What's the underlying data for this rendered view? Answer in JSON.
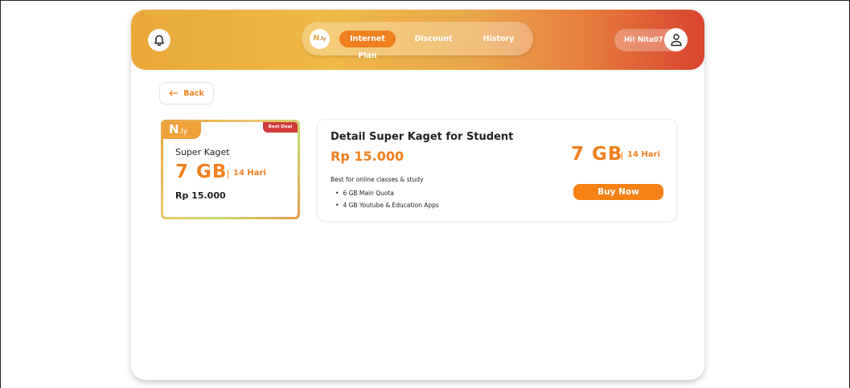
{
  "header": {
    "bell_icon": "bell-icon",
    "nav": {
      "logo": "N",
      "logo_suffix": ".ly",
      "items": [
        {
          "label": "Internet Plan",
          "active": true
        },
        {
          "label": "Discount",
          "active": false
        },
        {
          "label": "History",
          "active": false
        }
      ]
    },
    "user": {
      "greeting": "Hi! Nita07",
      "avatar_icon": "user-icon"
    }
  },
  "back_button": {
    "label": "Back",
    "icon": "arrow-left-icon"
  },
  "plan_card": {
    "logo": "N",
    "logo_suffix": ".ly",
    "badge": "Best Deal",
    "name": "Super Kaget",
    "quota": "7 GB",
    "days": "14 Hari",
    "price": "Rp 15.000"
  },
  "detail": {
    "title": "Detail Super Kaget for Student",
    "price": "Rp 15.000",
    "description": "Best for online classes & study",
    "features": [
      "6 GB Main Quota",
      "4 GB Youtube & Education Apps"
    ],
    "quota": "7 GB",
    "days": "14 Hari",
    "buy_label": "Buy Now"
  },
  "colors": {
    "accent": "#f07f1e",
    "badge": "#d23b3b"
  }
}
